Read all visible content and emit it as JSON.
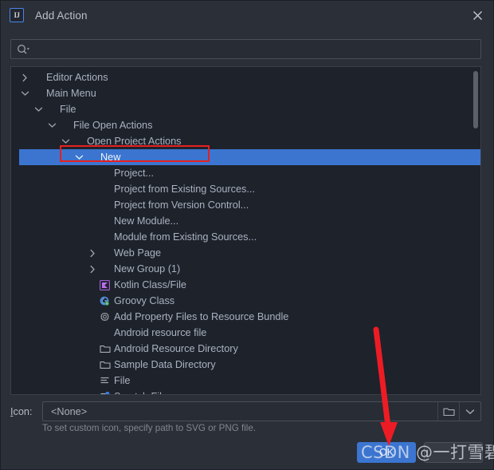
{
  "window": {
    "title": "Add Action",
    "app_icon": "IJ",
    "close_label": "×"
  },
  "search": {
    "value": "",
    "placeholder": "",
    "icon": "search-icon"
  },
  "tree": {
    "items": [
      {
        "label": "Editor Actions",
        "depth": 0,
        "chevron": "right",
        "icon": "none",
        "selected": false
      },
      {
        "label": "Main Menu",
        "depth": 0,
        "chevron": "down",
        "icon": "none",
        "selected": false
      },
      {
        "label": "File",
        "depth": 1,
        "chevron": "down",
        "icon": "none",
        "selected": false
      },
      {
        "label": "File Open Actions",
        "depth": 2,
        "chevron": "down",
        "icon": "none",
        "selected": false
      },
      {
        "label": "Open Project Actions",
        "depth": 3,
        "chevron": "down",
        "icon": "none",
        "selected": false
      },
      {
        "label": "New",
        "depth": 4,
        "chevron": "down",
        "icon": "none",
        "selected": true
      },
      {
        "label": "Project...",
        "depth": 5,
        "chevron": "none",
        "icon": "none",
        "selected": false
      },
      {
        "label": "Project from Existing Sources...",
        "depth": 5,
        "chevron": "none",
        "icon": "none",
        "selected": false
      },
      {
        "label": "Project from Version Control...",
        "depth": 5,
        "chevron": "none",
        "icon": "none",
        "selected": false
      },
      {
        "label": "New Module...",
        "depth": 5,
        "chevron": "none",
        "icon": "none",
        "selected": false
      },
      {
        "label": "Module from Existing Sources...",
        "depth": 5,
        "chevron": "none",
        "icon": "none",
        "selected": false
      },
      {
        "label": "Web Page",
        "depth": 5,
        "chevron": "right",
        "icon": "none",
        "selected": false
      },
      {
        "label": "New Group (1)",
        "depth": 5,
        "chevron": "right",
        "icon": "none",
        "selected": false
      },
      {
        "label": "Kotlin Class/File",
        "depth": 5,
        "chevron": "none",
        "icon": "kotlin-icon",
        "selected": false
      },
      {
        "label": "Groovy Class",
        "depth": 5,
        "chevron": "none",
        "icon": "groovy-icon",
        "selected": false
      },
      {
        "label": "Add Property Files to Resource Bundle",
        "depth": 5,
        "chevron": "none",
        "icon": "gear-icon",
        "selected": false
      },
      {
        "label": "Android resource file",
        "depth": 5,
        "chevron": "none",
        "icon": "none",
        "selected": false
      },
      {
        "label": "Android Resource Directory",
        "depth": 5,
        "chevron": "none",
        "icon": "folder-icon",
        "selected": false
      },
      {
        "label": "Sample Data Directory",
        "depth": 5,
        "chevron": "none",
        "icon": "folder-icon",
        "selected": false
      },
      {
        "label": "File",
        "depth": 5,
        "chevron": "none",
        "icon": "file-lines-icon",
        "selected": false
      },
      {
        "label": "Scratch File",
        "depth": 5,
        "chevron": "none",
        "icon": "scratch-file-icon",
        "selected": false
      }
    ]
  },
  "icon_field": {
    "label": "Icon:",
    "value": "<None>",
    "browse_icon": "folder-icon",
    "dropdown_icon": "chevron-down-icon",
    "helper_text": "To set custom icon, specify path to SVG or PNG file."
  },
  "buttons": {
    "ok_label": "OK",
    "cancel_label": ""
  },
  "annotations": {
    "highlight_target": "New",
    "arrow_target": "OK"
  },
  "watermark": {
    "text": "CSDN @一打雪碧"
  },
  "colors": {
    "selection_blue": "#3b75d0",
    "annotation_red": "#e81f1f",
    "dialog_bg": "#2b2f38",
    "list_bg": "#1e222b"
  }
}
